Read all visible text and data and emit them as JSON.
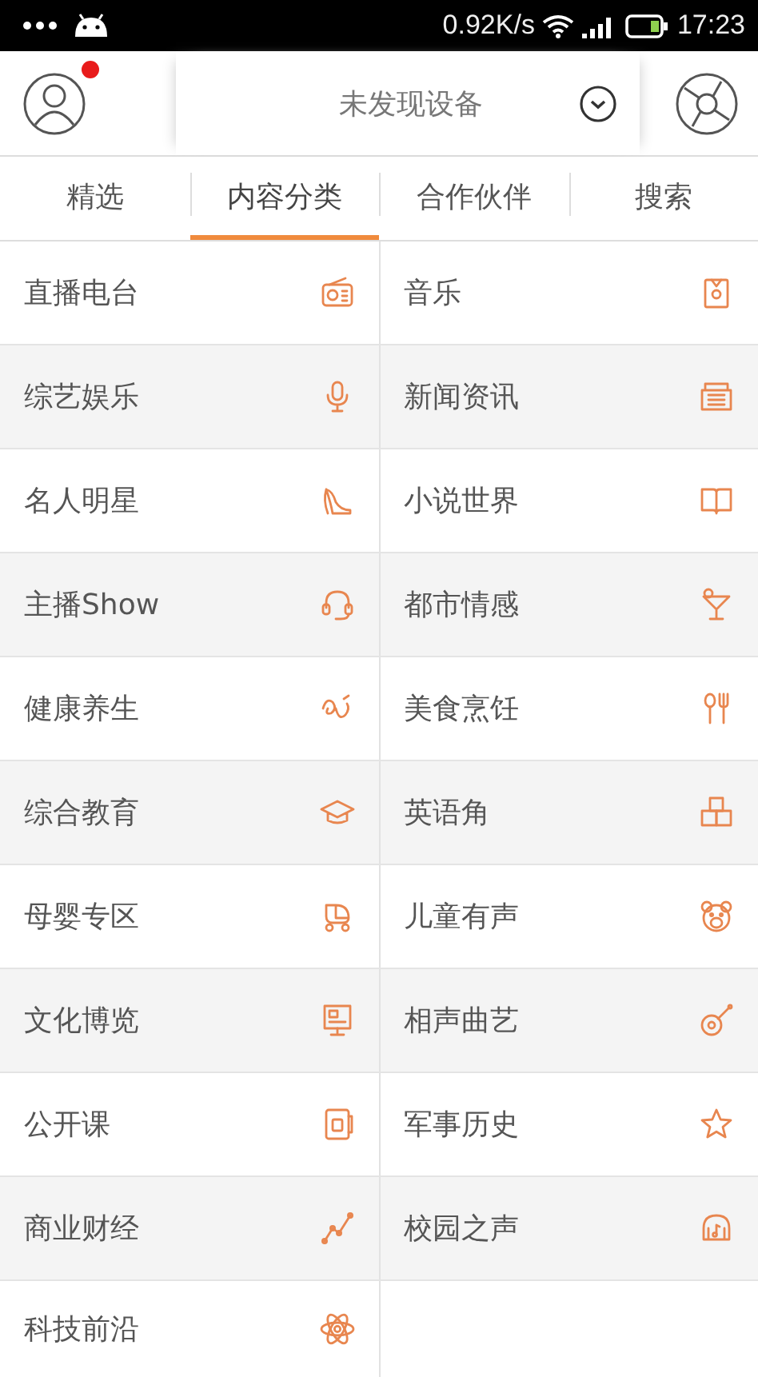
{
  "status_bar": {
    "speed": "0.92K/s",
    "time": "17:23"
  },
  "header": {
    "avatar_badge": true,
    "device_selector": "未发现设备"
  },
  "tabs": [
    {
      "label": "精选",
      "selected": false
    },
    {
      "label": "内容分类",
      "selected": true
    },
    {
      "label": "合作伙伴",
      "selected": false
    },
    {
      "label": "搜索",
      "selected": false
    }
  ],
  "categories": [
    {
      "label": "直播电台"
    },
    {
      "label": "音乐"
    },
    {
      "label": "综艺娱乐"
    },
    {
      "label": "新闻资讯"
    },
    {
      "label": "名人明星"
    },
    {
      "label": "小说世界"
    },
    {
      "label": "主播Show"
    },
    {
      "label": "都市情感"
    },
    {
      "label": "健康养生"
    },
    {
      "label": "美食烹饪"
    },
    {
      "label": "综合教育"
    },
    {
      "label": "英语角"
    },
    {
      "label": "母婴专区"
    },
    {
      "label": "儿童有声"
    },
    {
      "label": "文化博览"
    },
    {
      "label": "相声曲艺"
    },
    {
      "label": "公开课"
    },
    {
      "label": "军事历史"
    },
    {
      "label": "商业财经"
    },
    {
      "label": "校园之声"
    },
    {
      "label": "科技前沿"
    }
  ]
}
